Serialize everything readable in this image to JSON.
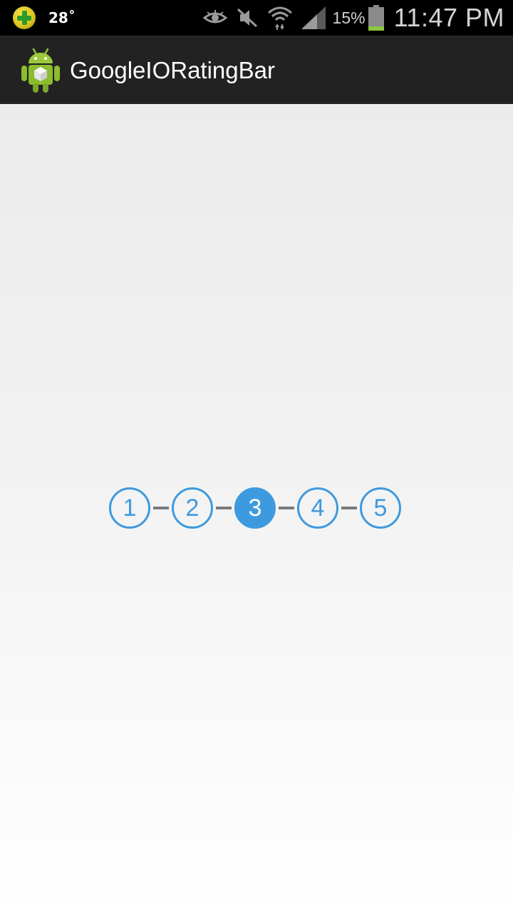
{
  "status_bar": {
    "temperature": "28˚",
    "battery_percent": "15%",
    "battery_level": 0.15,
    "time": "11:47 PM",
    "icons": [
      "weather-app-icon",
      "eye-icon",
      "mute-icon",
      "wifi-icon",
      "signal-icon",
      "battery-icon"
    ]
  },
  "action_bar": {
    "title": "GoogleIORatingBar",
    "logo_icon": "android-app-icon"
  },
  "rating_bar": {
    "items": [
      "1",
      "2",
      "3",
      "4",
      "5"
    ],
    "selected_value": 3,
    "accent_color": "#3e9ade",
    "connector_color": "#7a7a7a"
  }
}
